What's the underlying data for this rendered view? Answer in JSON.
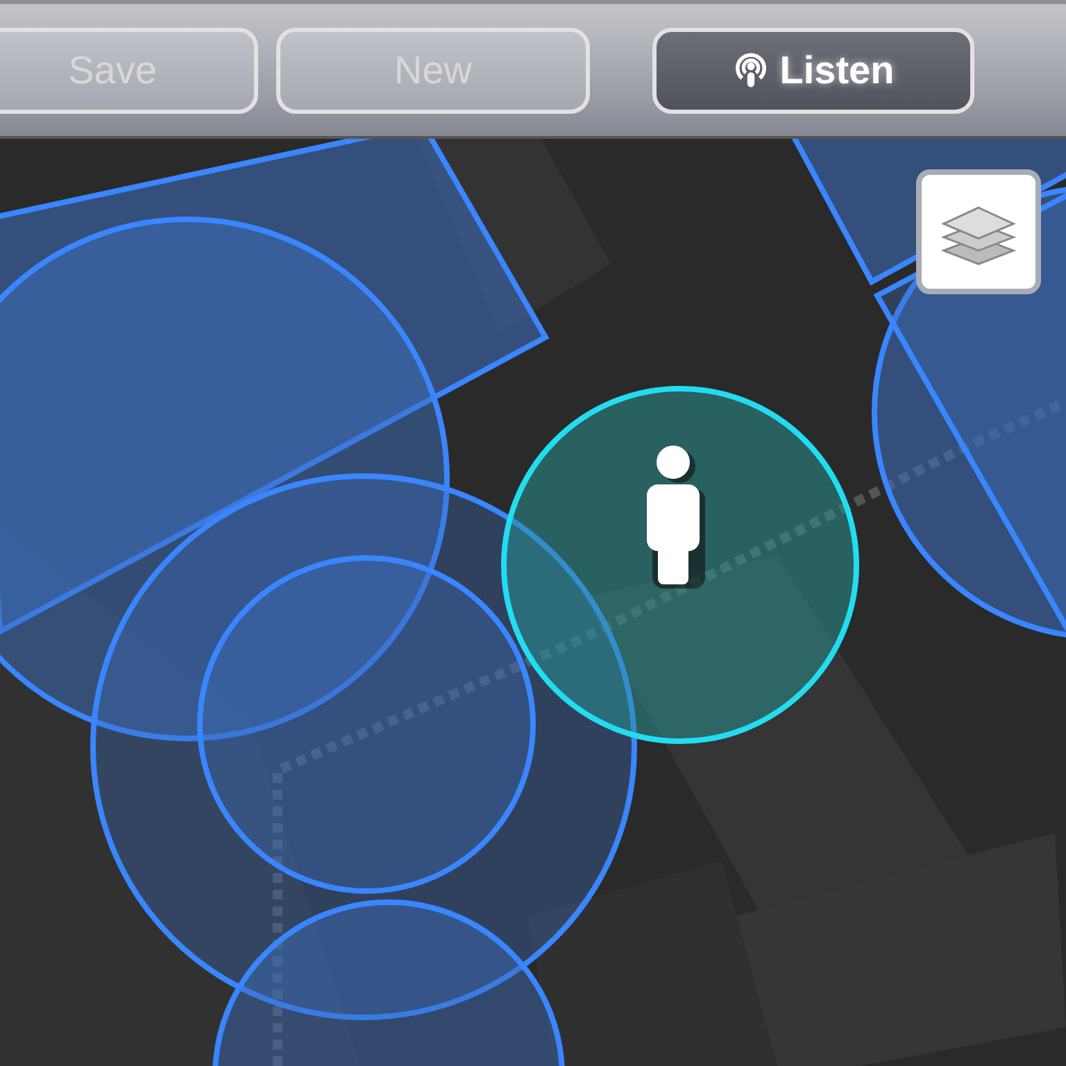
{
  "toolbar": {
    "buttons": [
      {
        "label": "Save",
        "disabled": true,
        "active": false
      },
      {
        "label": "New",
        "disabled": true,
        "active": false
      },
      {
        "label": "Listen",
        "disabled": false,
        "active": true,
        "kind": "listen"
      }
    ]
  }
}
